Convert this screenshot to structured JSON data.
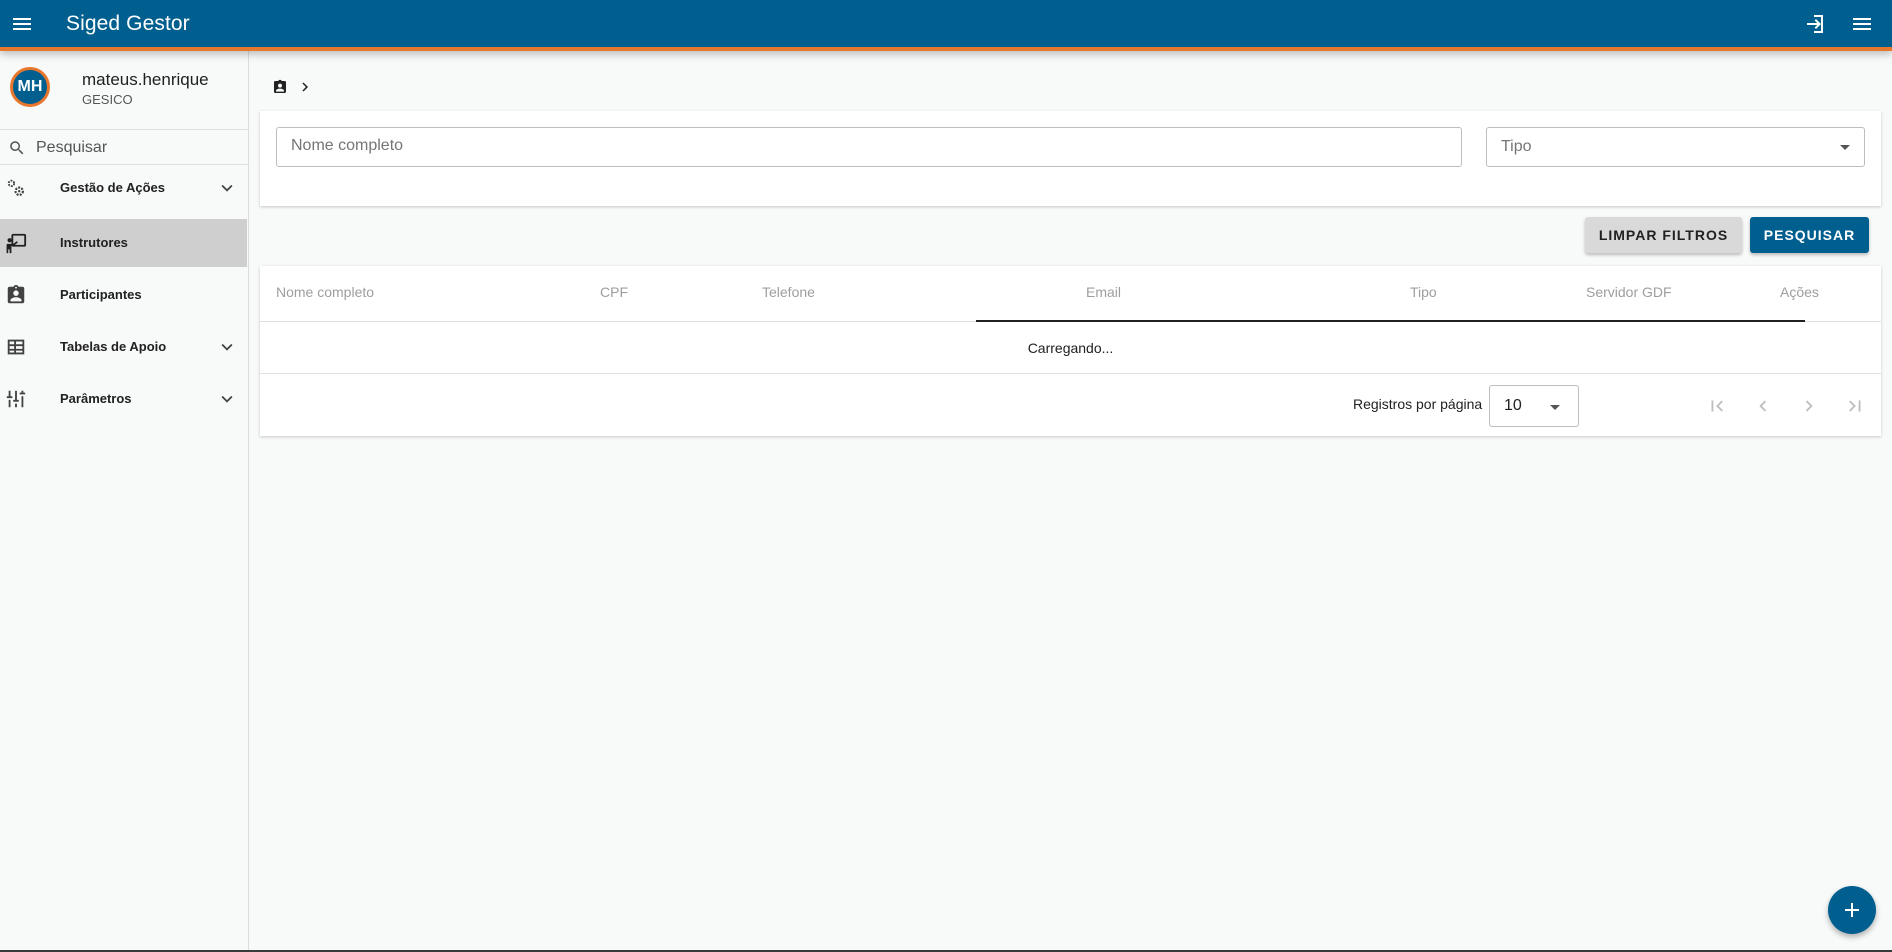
{
  "app": {
    "title": "Siged Gestor",
    "colors": {
      "primary": "#005f8f",
      "accent": "#e8772e",
      "active_item": "#cfcfcf"
    }
  },
  "user": {
    "initials": "MH",
    "name": "mateus.henrique",
    "org": "GESICO"
  },
  "sidebar": {
    "search_placeholder": "Pesquisar",
    "items": [
      {
        "label": "Gestão de Ações",
        "icon": "gears-icon",
        "expandable": true
      },
      {
        "label": "Instrutores",
        "icon": "instructor-icon",
        "expandable": false,
        "active": true
      },
      {
        "label": "Participantes",
        "icon": "badge-icon",
        "expandable": false
      },
      {
        "label": "Tabelas de Apoio",
        "icon": "table-icon",
        "expandable": true
      },
      {
        "label": "Parâmetros",
        "icon": "sliders-icon",
        "expandable": true
      }
    ]
  },
  "breadcrumb": {
    "icon": "badge-icon",
    "separator": "chevron-right-icon"
  },
  "filters": {
    "name_placeholder": "Nome completo",
    "type_placeholder": "Tipo"
  },
  "actions": {
    "clear_label": "LIMPAR FILTROS",
    "search_label": "PESQUISAR"
  },
  "table": {
    "columns": [
      "Nome completo",
      "CPF",
      "Telefone",
      "Email",
      "Tipo",
      "Servidor GDF",
      "Ações"
    ],
    "loading_text": "Carregando...",
    "rows_per_page_label": "Registros por página",
    "rows_per_page": "10"
  }
}
